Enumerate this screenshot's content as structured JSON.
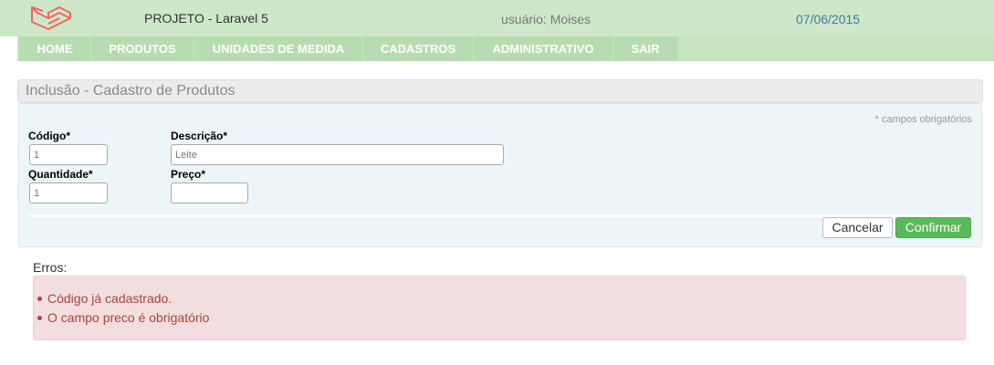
{
  "header": {
    "project": "PROJETO - Laravel 5",
    "user": "usuário: Moises",
    "date": "07/06/2015",
    "logo_icon": "laravel-logo-icon",
    "brand_color": "#f4645f"
  },
  "nav": {
    "home": "HOME",
    "produtos": "PRODUTOS",
    "unidades": "UNIDADES DE MEDIDA",
    "cadastros": "CADASTROS",
    "administrativo": "ADMINISTRATIVO",
    "sair": "SAIR"
  },
  "panel": {
    "title": "Inclusão - Cadastro de Produtos"
  },
  "form": {
    "required_note": "* campos obrigatórios",
    "codigo_label": "Código*",
    "codigo_placeholder": "1",
    "descricao_label": "Descrição*",
    "descricao_placeholder": "Leite",
    "quantidade_label": "Quantidade*",
    "quantidade_placeholder": "1",
    "preco_label": "Preço*",
    "preco_placeholder": "",
    "cancel": "Cancelar",
    "confirm": "Confirmar"
  },
  "errors": {
    "title": "Erros:",
    "items": [
      "Código já cadastrado.",
      "O campo preco é obrigatório"
    ]
  }
}
